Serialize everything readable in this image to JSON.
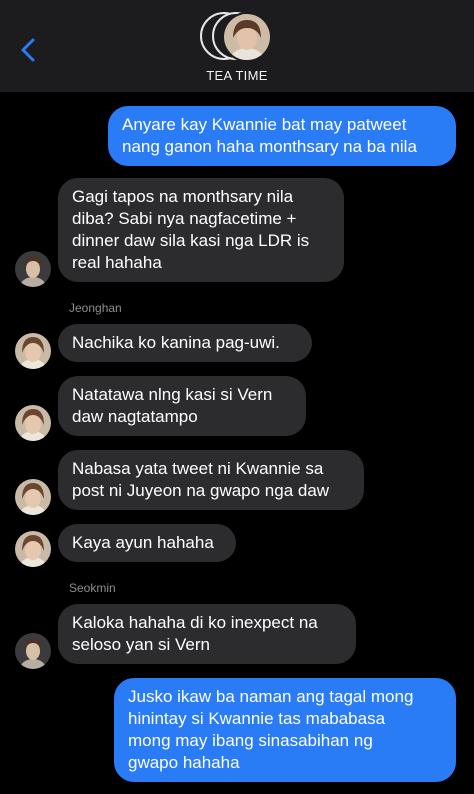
{
  "header": {
    "title": "TEA TIME",
    "back_icon": "chevron-left-icon",
    "accent": "#2a7cf6"
  },
  "colors": {
    "outgoing_bubble": "#2a7cf6",
    "incoming_bubble": "#2c2c2e",
    "background": "#000000",
    "sender_label": "#8d8d92"
  },
  "messages": [
    {
      "direction": "out",
      "text": "Anyare kay Kwannie bat may patweet\nnang ganon haha monthsary na ba nila"
    },
    {
      "direction": "in",
      "text": "Gagi tapos na monthsary nila\ndiba? Sabi nya nagfacetime +\ndinner daw sila kasi nga LDR is\nreal hahaha"
    },
    {
      "direction": "in",
      "sender": "Jeonghan",
      "text": "Nachika ko kanina pag-uwi."
    },
    {
      "direction": "in",
      "text": "Natatawa nlng kasi si Vern\ndaw nagtatampo"
    },
    {
      "direction": "in",
      "text": "Nabasa yata tweet ni Kwannie sa\npost ni Juyeon na gwapo nga daw"
    },
    {
      "direction": "in",
      "text": "Kaya ayun hahaha"
    },
    {
      "direction": "in",
      "sender": "Seokmin",
      "text": "Kaloka hahaha di ko inexpect na\nseloso yan si Vern"
    },
    {
      "direction": "out",
      "text": "Jusko ikaw ba naman ang tagal mong\nhinintay si Kwannie tas mababasa\nmong may ibang sinasabihan ng\ngwapo hahaha"
    }
  ]
}
